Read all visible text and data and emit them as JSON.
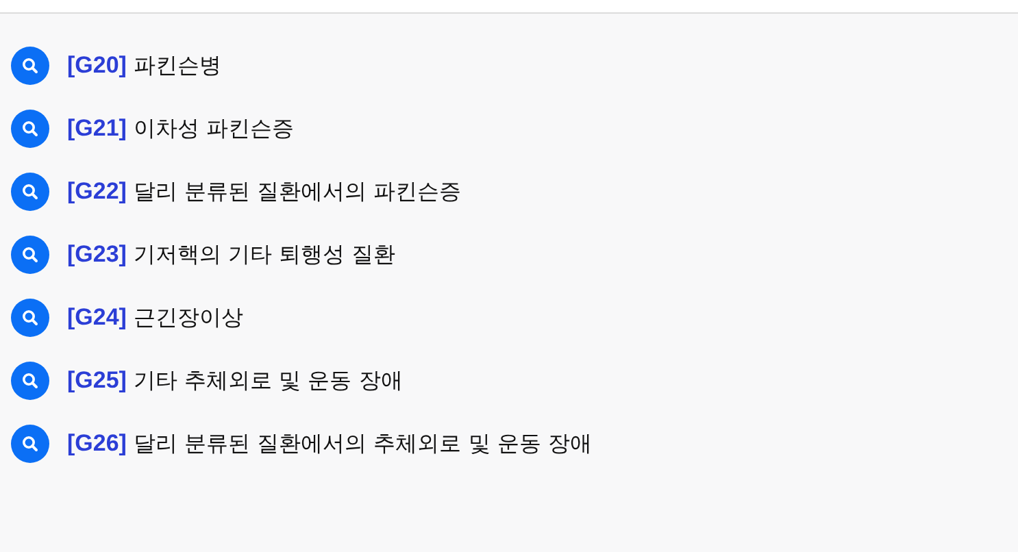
{
  "items": [
    {
      "code": "[G20]",
      "title": "파킨슨병"
    },
    {
      "code": "[G21]",
      "title": "이차성 파킨슨증"
    },
    {
      "code": "[G22]",
      "title": "달리 분류된 질환에서의 파킨슨증"
    },
    {
      "code": "[G23]",
      "title": "기저핵의 기타 퇴행성 질환"
    },
    {
      "code": "[G24]",
      "title": "근긴장이상"
    },
    {
      "code": "[G25]",
      "title": "기타 추체외로 및 운동 장애"
    },
    {
      "code": "[G26]",
      "title": "달리 분류된 질환에서의 추체외로 및 운동 장애"
    }
  ]
}
